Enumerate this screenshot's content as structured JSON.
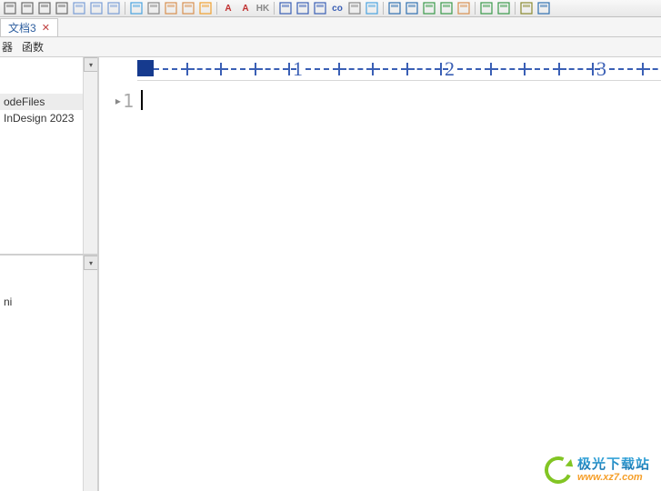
{
  "toolbar_icons": [
    {
      "name": "layout-icon",
      "color": "#6a6a6a"
    },
    {
      "name": "window-icon",
      "color": "#6a6a6a"
    },
    {
      "name": "copy-icon",
      "color": "#6a6a6a"
    },
    {
      "name": "frame-icon",
      "color": "#6a6a6a"
    },
    {
      "name": "page-icon",
      "color": "#7a9ed6"
    },
    {
      "name": "page2-icon",
      "color": "#7a9ed6"
    },
    {
      "name": "page3-icon",
      "color": "#7a9ed6"
    },
    {
      "name": "sep"
    },
    {
      "name": "scissors-icon",
      "color": "#4aa3e0"
    },
    {
      "name": "search-icon",
      "color": "#888"
    },
    {
      "name": "undo-icon",
      "color": "#d89050"
    },
    {
      "name": "redo-icon",
      "color": "#d89050"
    },
    {
      "name": "fill-icon",
      "color": "#f0a030"
    },
    {
      "name": "sep"
    },
    {
      "name": "text-a-icon",
      "color": "#c03030",
      "glyph": "A"
    },
    {
      "name": "text-a2-icon",
      "color": "#c03030",
      "glyph": "A"
    },
    {
      "name": "bold-icon",
      "color": "#888",
      "glyph": "HK"
    },
    {
      "name": "sep"
    },
    {
      "name": "nav-left-icon",
      "color": "#3a5fb5"
    },
    {
      "name": "nav-right-icon",
      "color": "#3a5fb5"
    },
    {
      "name": "nav-end-icon",
      "color": "#3a5fb5"
    },
    {
      "name": "link-icon",
      "color": "#3a5fb5",
      "glyph": "co"
    },
    {
      "name": "break-icon",
      "color": "#888"
    },
    {
      "name": "chain-icon",
      "color": "#4aa3e0"
    },
    {
      "name": "sep"
    },
    {
      "name": "book-icon",
      "color": "#3070b0"
    },
    {
      "name": "book2-icon",
      "color": "#3070b0"
    },
    {
      "name": "cal-icon",
      "color": "#3a9a4a"
    },
    {
      "name": "cal2-icon",
      "color": "#3a9a4a"
    },
    {
      "name": "note-icon",
      "color": "#d89050"
    },
    {
      "name": "sep"
    },
    {
      "name": "table-icon",
      "color": "#3a9a4a"
    },
    {
      "name": "play-icon",
      "color": "#3a9a4a"
    },
    {
      "name": "sep"
    },
    {
      "name": "app-icon",
      "color": "#8a8a30"
    },
    {
      "name": "gear-icon",
      "color": "#3070b0"
    }
  ],
  "tab": {
    "label": "文档3"
  },
  "menu": {
    "item1": "器",
    "item2": "函数"
  },
  "sidebar": {
    "upper": [
      {
        "label": "odeFiles",
        "selected": true
      },
      {
        "label": "InDesign 2023",
        "selected": false
      }
    ],
    "lower": [
      {
        "label": "ni"
      },
      {
        "label": ""
      }
    ]
  },
  "ruler": {
    "marks": [
      "1",
      "2",
      "3"
    ]
  },
  "editor": {
    "line_number": "1"
  },
  "watermark": {
    "cn": "极光下载站",
    "url": "www.xz7.com"
  }
}
